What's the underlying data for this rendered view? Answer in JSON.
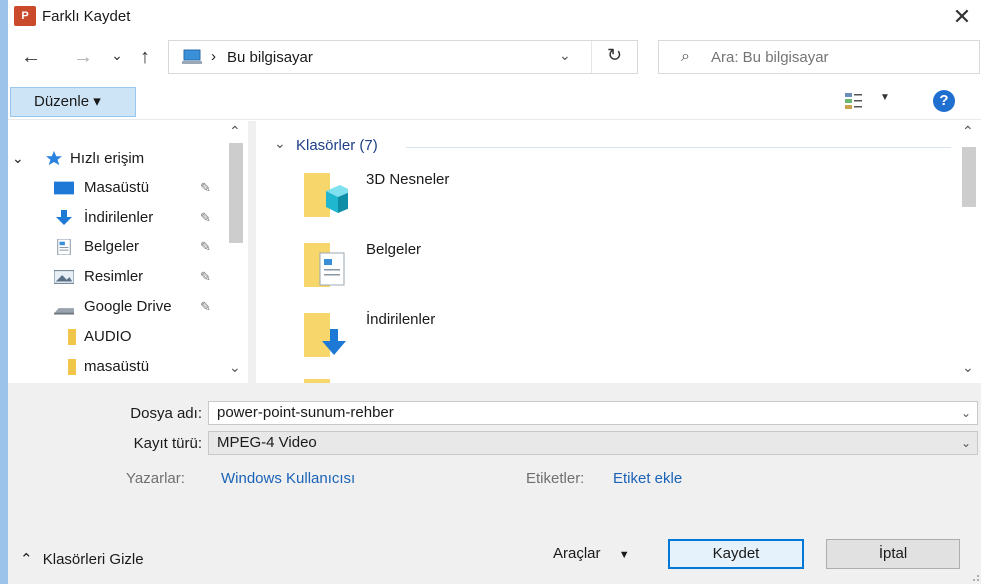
{
  "window": {
    "app_badge": "P",
    "title": "Farklı Kaydet",
    "close_glyph": "✕"
  },
  "nav": {
    "back_glyph": "←",
    "forward_glyph": "→",
    "recent_glyph": "⌄",
    "up_glyph": "↑",
    "address_chevron": "›",
    "address_path": "Bu bilgisayar",
    "address_dropdown_glyph": "⌄",
    "refresh_glyph": "↻",
    "search_icon": "⌕",
    "search_placeholder": "Ara: Bu bilgisayar"
  },
  "toolbar": {
    "organize_label": "Düzenle ▾",
    "view_dropdown_glyph": "▼",
    "help_label": "?"
  },
  "sidebar": {
    "quick_access_label": "Hızlı erişim",
    "expand_glyph": "⌄",
    "pin_glyph": "✎",
    "items": [
      {
        "label": "Masaüstü",
        "icon": "desktop-icon",
        "pinned": true
      },
      {
        "label": "İndirilenler",
        "icon": "download-icon",
        "pinned": true
      },
      {
        "label": "Belgeler",
        "icon": "documents-icon",
        "pinned": true
      },
      {
        "label": "Resimler",
        "icon": "pictures-icon",
        "pinned": true
      },
      {
        "label": "Google Drive",
        "icon": "drive-icon",
        "pinned": true
      },
      {
        "label": "AUDIO",
        "icon": "folder-icon",
        "pinned": false
      },
      {
        "label": "masaüstü",
        "icon": "folder-icon",
        "pinned": false
      }
    ],
    "scroll_up_glyph": "⌃",
    "scroll_down_glyph": "⌄"
  },
  "main": {
    "group_label": "Klasörler (7)",
    "group_chevron": "⌄",
    "folders": [
      {
        "label": "3D Nesneler",
        "icon": "3d-objects-folder-icon"
      },
      {
        "label": "Belgeler",
        "icon": "documents-folder-icon"
      },
      {
        "label": "İndirilenler",
        "icon": "downloads-folder-icon"
      }
    ],
    "scroll_up_glyph": "⌃",
    "scroll_down_glyph": "⌄"
  },
  "form": {
    "filename_label": "Dosya adı:",
    "filename_value": "power-point-sunum-rehber",
    "filetype_label": "Kayıt türü:",
    "filetype_value": "MPEG-4 Video",
    "dropdown_glyph": "⌄",
    "authors_label": "Yazarlar:",
    "authors_value": "Windows Kullanıcısı",
    "tags_label": "Etiketler:",
    "tags_value": "Etiket ekle"
  },
  "footer": {
    "hide_folders_label": "Klasörleri Gizle",
    "hide_folders_glyph": "⌃",
    "tools_label": "Araçlar",
    "tools_glyph": "▼",
    "save_label": "Kaydet",
    "cancel_label": "İptal"
  },
  "colors": {
    "accent": "#0078d7",
    "link": "#1a63b8",
    "organize_bg": "#cde4f7",
    "window_border": "#9cc4ea"
  }
}
